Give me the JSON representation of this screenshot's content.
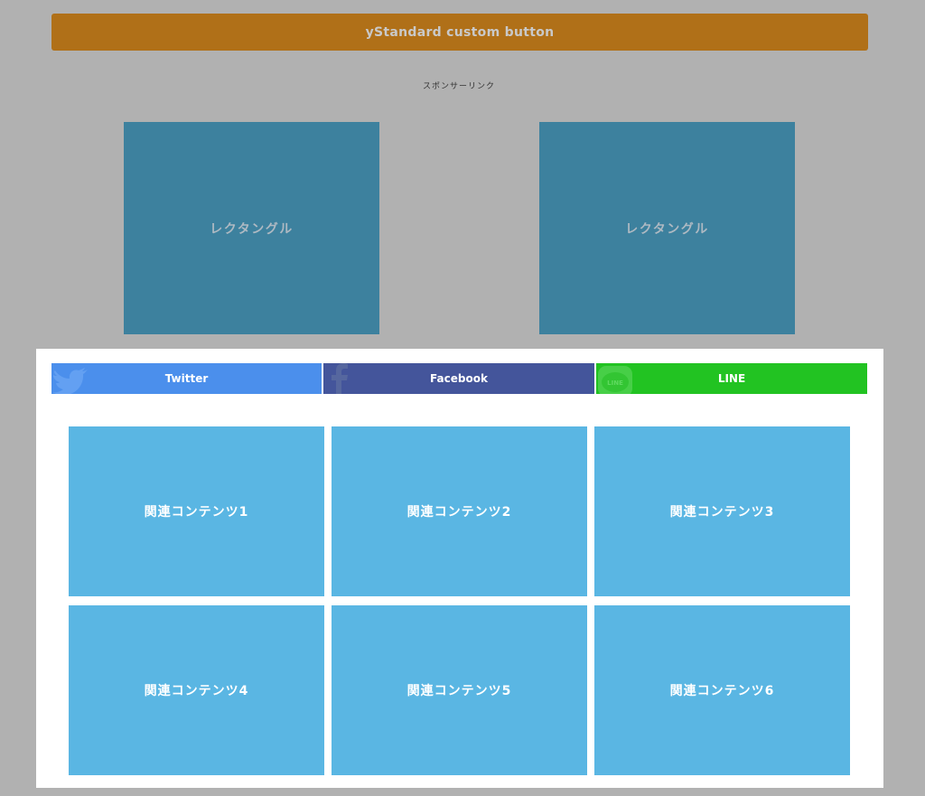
{
  "colors": {
    "page_background": "#b1b1b1",
    "custom_button": "#b07018",
    "ad_box": "#3d819e",
    "panel": "#ffffff",
    "twitter": "#4b8fec",
    "facebook": "#44559b",
    "line": "#22c322",
    "related": "#5ab6e3"
  },
  "custom_button": {
    "label": "yStandard custom button"
  },
  "sponsor": {
    "label": "スポンサーリンク"
  },
  "ads": [
    {
      "label": "レクタングル"
    },
    {
      "label": "レクタングル"
    }
  ],
  "share": {
    "twitter": {
      "label": "Twitter",
      "icon": "twitter-bird-icon"
    },
    "facebook": {
      "label": "Facebook",
      "icon": "facebook-f-icon"
    },
    "line": {
      "label": "LINE",
      "icon": "line-icon"
    }
  },
  "related": [
    {
      "label": "関連コンテンツ1"
    },
    {
      "label": "関連コンテンツ2"
    },
    {
      "label": "関連コンテンツ3"
    },
    {
      "label": "関連コンテンツ4"
    },
    {
      "label": "関連コンテンツ5"
    },
    {
      "label": "関連コンテンツ6"
    }
  ]
}
